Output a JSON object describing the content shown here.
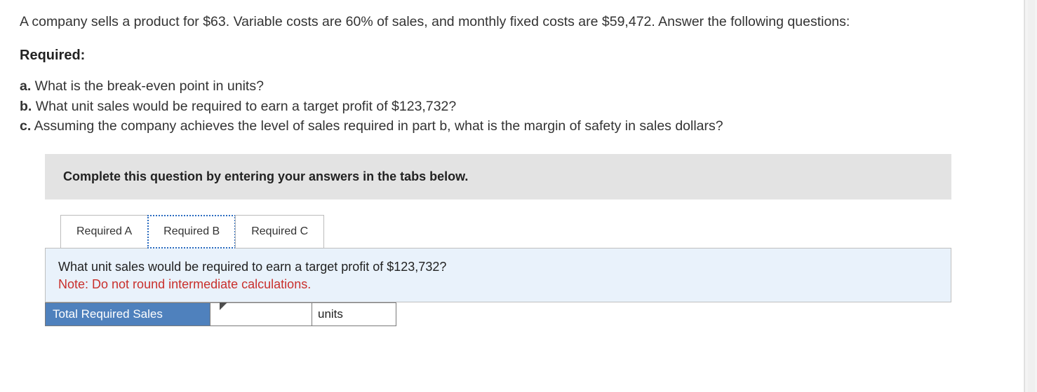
{
  "question": {
    "intro": "A company sells a product for $63. Variable costs are 60% of sales, and monthly fixed costs are $59,472. Answer the following questions:",
    "required_heading": "Required:",
    "items": {
      "a": {
        "letter": "a.",
        "text": " What is the break-even point in units?"
      },
      "b": {
        "letter": "b.",
        "text": " What unit sales would be required to earn a target profit of $123,732?"
      },
      "c": {
        "letter": "c.",
        "text": " Assuming the company achieves the level of sales required in part b, what is the margin of safety in sales dollars?"
      }
    }
  },
  "answer_area": {
    "instruction": "Complete this question by entering your answers in the tabs below.",
    "tabs": {
      "a": "Required A",
      "b": "Required B",
      "c": "Required C"
    },
    "active_tab": "b",
    "panel": {
      "prompt": "What unit sales would be required to earn a target profit of $123,732?",
      "note": "Note: Do not round intermediate calculations.",
      "row_label": "Total Required Sales",
      "input_value": "",
      "units_label": "units"
    }
  }
}
